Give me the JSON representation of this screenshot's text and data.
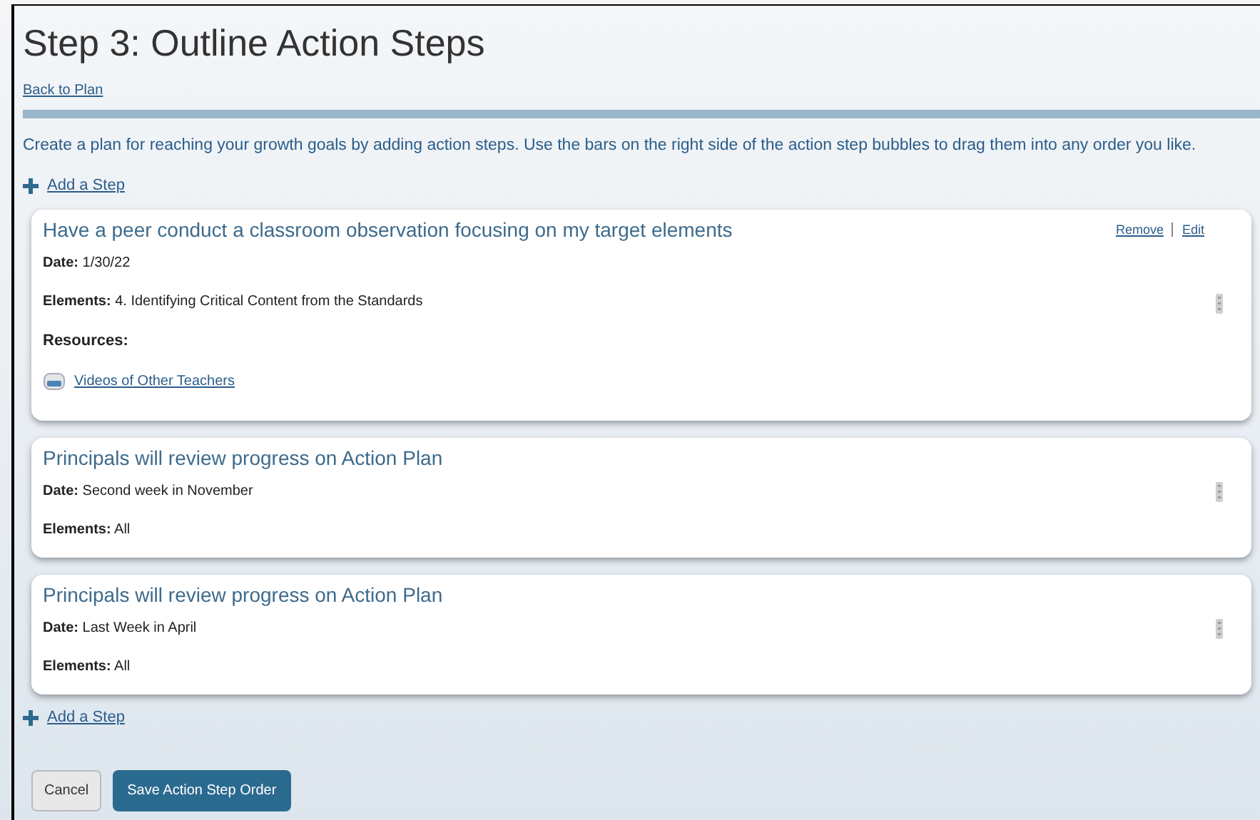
{
  "title": "Step 3: Outline Action Steps",
  "back_link": "Back to Plan",
  "instructions": "Create a plan for reaching your growth goals by adding action steps. Use the bars on the right side of the action step bubbles to drag them into any order you like.",
  "add_step_top": "Add a Step",
  "steps": [
    {
      "title": "Have a peer conduct a classroom observation focusing on my target elements",
      "actions": [
        "Remove",
        "Edit"
      ],
      "fields": [
        {
          "label": "Date:",
          "value": "1/30/22"
        },
        {
          "label": "Elements:",
          "value": "4. Identifying Critical Content from the Standards"
        }
      ],
      "resources_label": "Resources:",
      "resources": [
        "Videos of Other Teachers"
      ]
    },
    {
      "title": "Principals will review progress on Action Plan",
      "fields": [
        {
          "label": "Date:",
          "value": "Second week in November"
        },
        {
          "label": "Elements:",
          "value": "All"
        }
      ]
    },
    {
      "title": "Principals will review progress on Action Plan",
      "fields": [
        {
          "label": "Date:",
          "value": "Last Week in April"
        },
        {
          "label": "Elements:",
          "value": "All"
        }
      ]
    }
  ],
  "add_step_bottom": "Add a Step",
  "buttons": [
    {
      "label": "Cancel",
      "kind": "secondary"
    },
    {
      "label": "Save Action Step Order",
      "kind": "primary"
    }
  ]
}
